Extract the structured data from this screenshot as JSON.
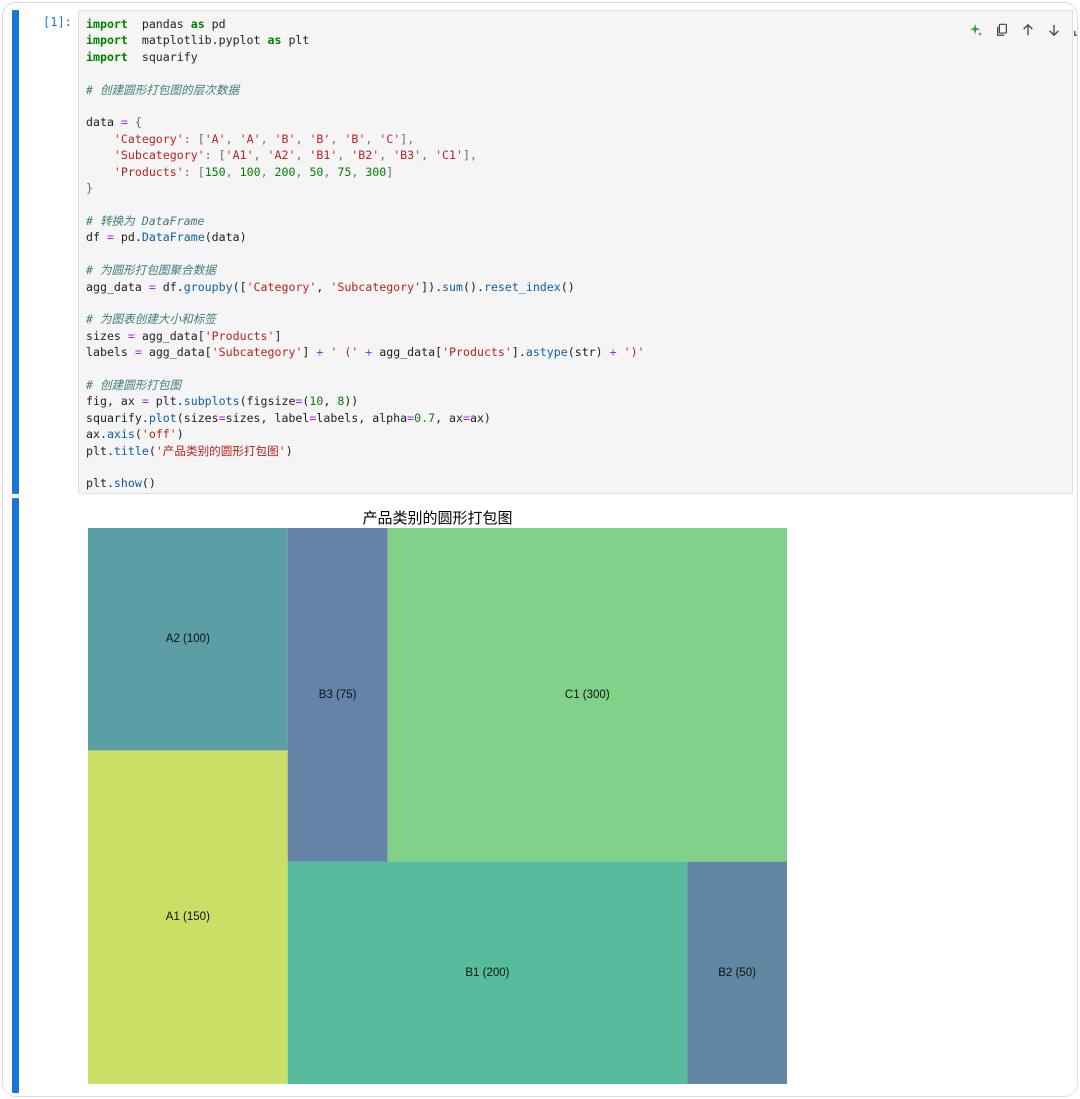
{
  "cell": {
    "prompt": "[1]:",
    "code_lines": [
      [
        [
          "kw",
          "import"
        ],
        [
          "",
          "  pandas "
        ],
        [
          "kw",
          "as"
        ],
        [
          "",
          " pd"
        ]
      ],
      [
        [
          "kw",
          "import"
        ],
        [
          "",
          "  matplotlib.pyplot "
        ],
        [
          "kw",
          "as"
        ],
        [
          "",
          " plt"
        ]
      ],
      [
        [
          "kw",
          "import"
        ],
        [
          "",
          "  squarify"
        ]
      ],
      [],
      [
        [
          "cm",
          "# 创建圆形打包图的层次数据"
        ]
      ],
      [],
      [
        [
          "",
          "data "
        ],
        [
          "op",
          "="
        ],
        [
          "",
          " "
        ],
        [
          "pu",
          "{"
        ]
      ],
      [
        [
          "",
          "    "
        ],
        [
          "st",
          "'Category'"
        ],
        [
          "pu",
          ": ["
        ],
        [
          "st",
          "'A'"
        ],
        [
          "pu",
          ", "
        ],
        [
          "st",
          "'A'"
        ],
        [
          "pu",
          ", "
        ],
        [
          "st",
          "'B'"
        ],
        [
          "pu",
          ", "
        ],
        [
          "st",
          "'B'"
        ],
        [
          "pu",
          ", "
        ],
        [
          "st",
          "'B'"
        ],
        [
          "pu",
          ", "
        ],
        [
          "st",
          "'C'"
        ],
        [
          "pu",
          "],"
        ]
      ],
      [
        [
          "",
          "    "
        ],
        [
          "st",
          "'Subcategory'"
        ],
        [
          "pu",
          ": ["
        ],
        [
          "st",
          "'A1'"
        ],
        [
          "pu",
          ", "
        ],
        [
          "st",
          "'A2'"
        ],
        [
          "pu",
          ", "
        ],
        [
          "st",
          "'B1'"
        ],
        [
          "pu",
          ", "
        ],
        [
          "st",
          "'B2'"
        ],
        [
          "pu",
          ", "
        ],
        [
          "st",
          "'B3'"
        ],
        [
          "pu",
          ", "
        ],
        [
          "st",
          "'C1'"
        ],
        [
          "pu",
          "],"
        ]
      ],
      [
        [
          "",
          "    "
        ],
        [
          "st",
          "'Products'"
        ],
        [
          "pu",
          ": ["
        ],
        [
          "nu",
          "150"
        ],
        [
          "pu",
          ", "
        ],
        [
          "nu",
          "100"
        ],
        [
          "pu",
          ", "
        ],
        [
          "nu",
          "200"
        ],
        [
          "pu",
          ", "
        ],
        [
          "nu",
          "50"
        ],
        [
          "pu",
          ", "
        ],
        [
          "nu",
          "75"
        ],
        [
          "pu",
          ", "
        ],
        [
          "nu",
          "300"
        ],
        [
          "pu",
          "]"
        ]
      ],
      [
        [
          "pu",
          "}"
        ]
      ],
      [],
      [
        [
          "cm",
          "# 转换为 DataFrame"
        ]
      ],
      [
        [
          "",
          "df "
        ],
        [
          "op",
          "="
        ],
        [
          "",
          " pd."
        ],
        [
          "fn",
          "DataFrame"
        ],
        [
          "",
          "(data)"
        ]
      ],
      [],
      [
        [
          "cm",
          "# 为圆形打包图聚合数据"
        ]
      ],
      [
        [
          "",
          "agg_data "
        ],
        [
          "op",
          "="
        ],
        [
          "",
          " df."
        ],
        [
          "fn",
          "groupby"
        ],
        [
          "",
          "(["
        ],
        [
          "st",
          "'Category'"
        ],
        [
          "",
          ", "
        ],
        [
          "st",
          "'Subcategory'"
        ],
        [
          "",
          "])."
        ],
        [
          "fn",
          "sum"
        ],
        [
          "",
          "()."
        ],
        [
          "fn",
          "reset_index"
        ],
        [
          "",
          "()"
        ]
      ],
      [],
      [
        [
          "cm",
          "# 为图表创建大小和标签"
        ]
      ],
      [
        [
          "",
          "sizes "
        ],
        [
          "op",
          "="
        ],
        [
          "",
          " agg_data["
        ],
        [
          "st",
          "'Products'"
        ],
        [
          "",
          "]"
        ]
      ],
      [
        [
          "",
          "labels "
        ],
        [
          "op",
          "="
        ],
        [
          "",
          " agg_data["
        ],
        [
          "st",
          "'Subcategory'"
        ],
        [
          "",
          "] "
        ],
        [
          "op",
          "+"
        ],
        [
          "",
          " "
        ],
        [
          "st",
          "' ('"
        ],
        [
          "",
          " "
        ],
        [
          "op",
          "+"
        ],
        [
          "",
          " agg_data["
        ],
        [
          "st",
          "'Products'"
        ],
        [
          "",
          "]."
        ],
        [
          "fn",
          "astype"
        ],
        [
          "",
          "(str) "
        ],
        [
          "op",
          "+"
        ],
        [
          "",
          " "
        ],
        [
          "st",
          "')'"
        ]
      ],
      [],
      [
        [
          "cm",
          "# 创建圆形打包图"
        ]
      ],
      [
        [
          "",
          "fig, ax "
        ],
        [
          "op",
          "="
        ],
        [
          "",
          " plt."
        ],
        [
          "fn",
          "subplots"
        ],
        [
          "",
          "(figsize"
        ],
        [
          "op",
          "="
        ],
        [
          "",
          "("
        ],
        [
          "nu",
          "10"
        ],
        [
          "",
          ", "
        ],
        [
          "nu",
          "8"
        ],
        [
          "",
          "))"
        ]
      ],
      [
        [
          "",
          "squarify."
        ],
        [
          "fn",
          "plot"
        ],
        [
          "",
          "(sizes"
        ],
        [
          "op",
          "="
        ],
        [
          "",
          "sizes, label"
        ],
        [
          "op",
          "="
        ],
        [
          "",
          "labels, alpha"
        ],
        [
          "op",
          "="
        ],
        [
          "nu",
          "0.7"
        ],
        [
          "",
          ", ax"
        ],
        [
          "op",
          "="
        ],
        [
          "",
          "ax)"
        ]
      ],
      [
        [
          "",
          "ax."
        ],
        [
          "fn",
          "axis"
        ],
        [
          "",
          "("
        ],
        [
          "st",
          "'off'"
        ],
        [
          "",
          ")"
        ]
      ],
      [
        [
          "",
          "plt."
        ],
        [
          "fn",
          "title"
        ],
        [
          "",
          "("
        ],
        [
          "st",
          "'产品类别的圆形打包图'"
        ],
        [
          "",
          ")"
        ]
      ],
      [],
      [
        [
          "",
          "plt."
        ],
        [
          "fn",
          "show"
        ],
        [
          "",
          "()"
        ]
      ]
    ]
  },
  "toolbar": {
    "icons": [
      "sparkle-icon",
      "copy-icon",
      "move-up-icon",
      "move-down-icon",
      "insert-above-icon",
      "insert-below-icon",
      "delete-icon"
    ]
  },
  "colors": {
    "cell_bar": "#1976d2",
    "code_bg": "#f5f5f5",
    "sparkle": "#2e9e3e"
  },
  "chart_data": {
    "type": "treemap",
    "title": "产品类别的圆形打包图",
    "norm_w": 10,
    "norm_h": 8,
    "items": [
      {
        "label": "A1 (150)",
        "value": 150,
        "color": "#cbdf67"
      },
      {
        "label": "A2 (100)",
        "value": 100,
        "color": "#5b9ea6"
      },
      {
        "label": "B1 (200)",
        "value": 200,
        "color": "#57bc9e"
      },
      {
        "label": "B2 (50)",
        "value": 50,
        "color": "#5f87a2"
      },
      {
        "label": "B3 (75)",
        "value": 75,
        "color": "#6383a7"
      },
      {
        "label": "C1 (300)",
        "value": 300,
        "color": "#82d189"
      }
    ]
  }
}
